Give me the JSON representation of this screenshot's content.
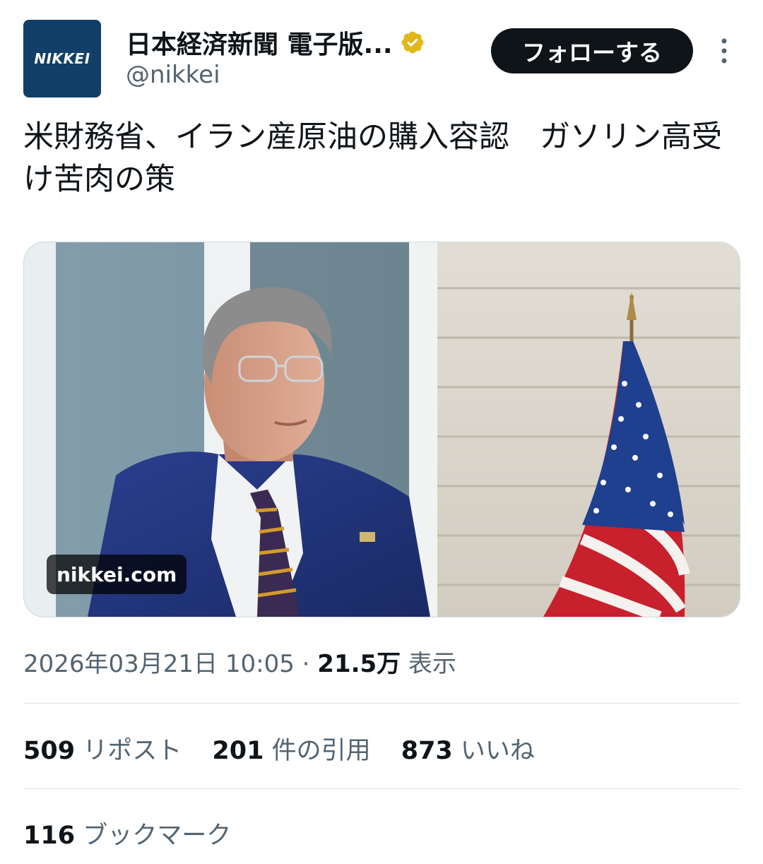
{
  "account": {
    "avatar_text": "NIKKEI",
    "display_name": "日本経済新聞 電子版...",
    "handle": "@nikkei",
    "verified_icon": "verified-badge-icon",
    "verified_color": "#e2b719"
  },
  "follow_button": {
    "label": "フォローする"
  },
  "more_icon": "more-options-icon",
  "tweet": {
    "text": "米財務省、イラン産原油の購入容認　ガソリン高受け苦肉の策"
  },
  "media": {
    "source_label": "nikkei.com",
    "image_description_icon": "photo-of-man-in-suit-with-us-flag"
  },
  "meta": {
    "datetime": "2026年03月21日 10:05",
    "separator": "·",
    "views_count": "21.5万",
    "views_label": "表示"
  },
  "stats": {
    "reposts_count": "509",
    "reposts_label": "リポスト",
    "quotes_count": "201",
    "quotes_label": "件の引用",
    "likes_count": "873",
    "likes_label": "いいね",
    "bookmarks_count": "116",
    "bookmarks_label": "ブックマーク"
  }
}
